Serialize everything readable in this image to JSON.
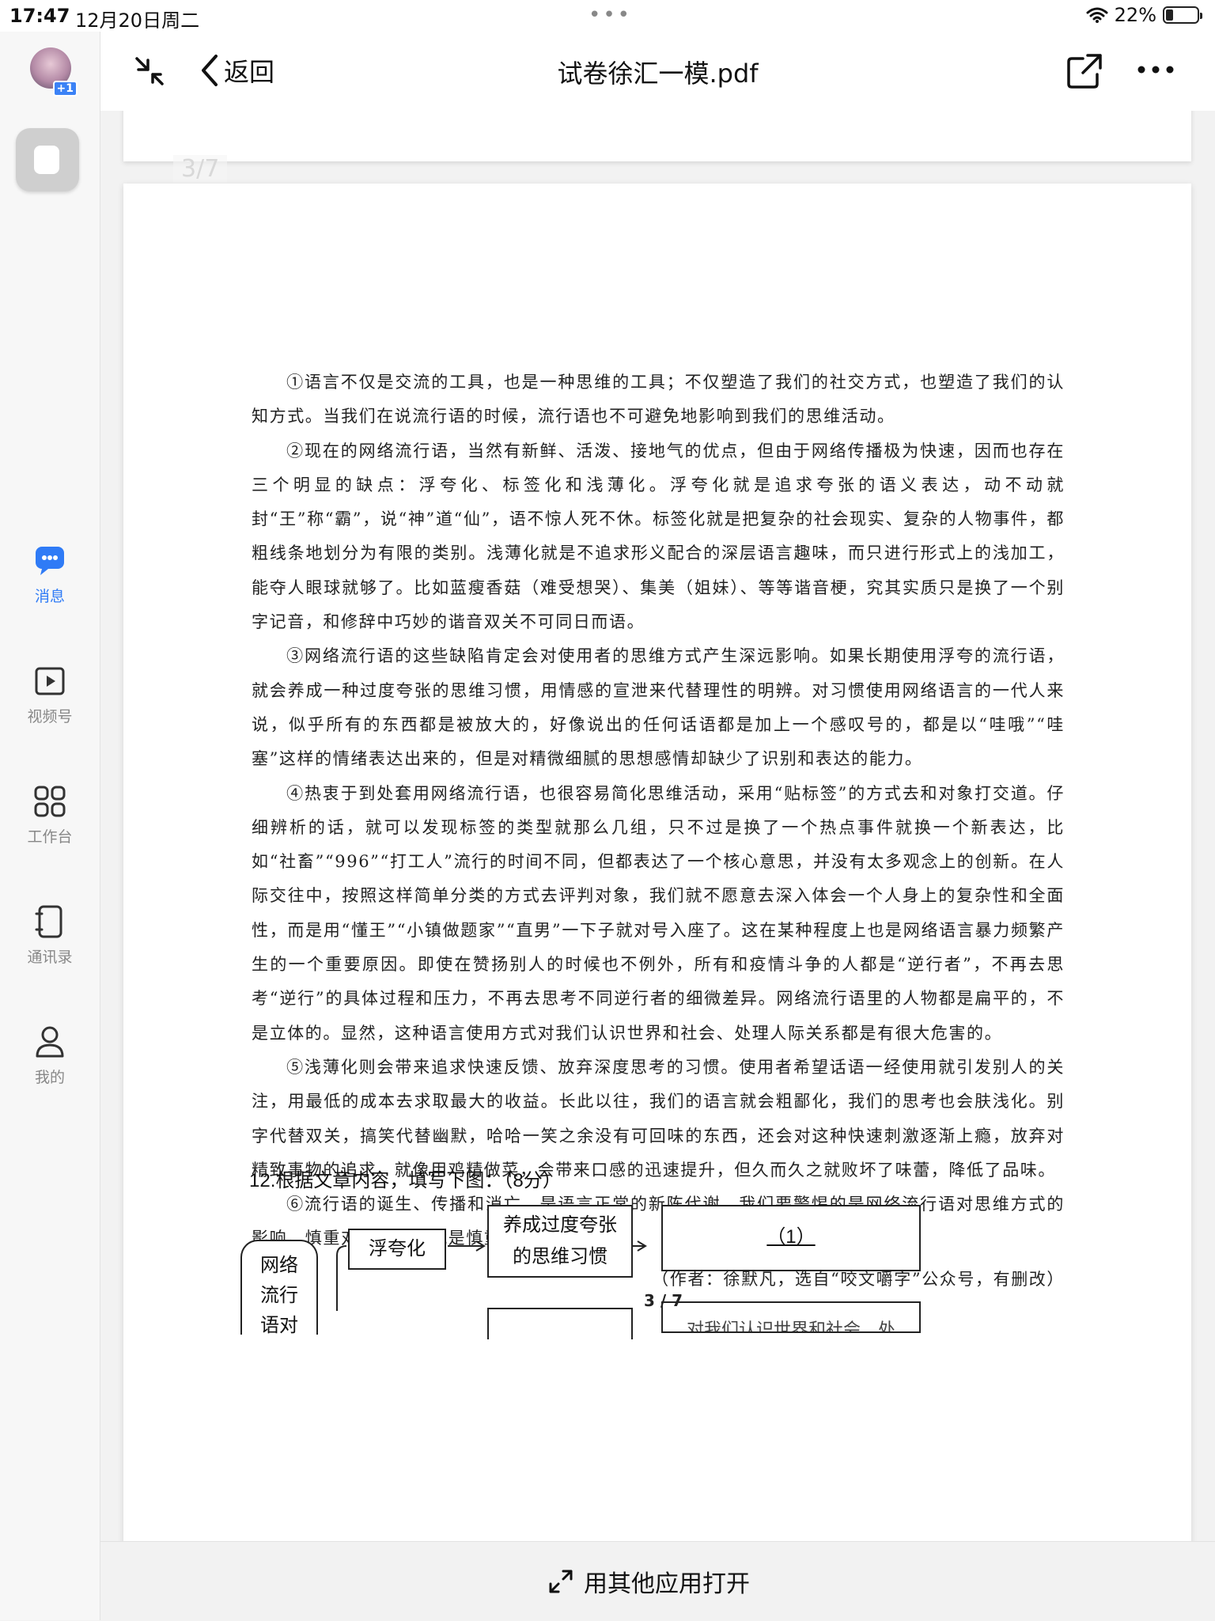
{
  "status_bar": {
    "time": "17:47",
    "date": "12月20日周二",
    "battery": "22%"
  },
  "sidebar": {
    "avatar_badge": "+1",
    "items": [
      {
        "label": "消息",
        "icon": "chat-icon",
        "active": true
      },
      {
        "label": "视频号",
        "icon": "video-channel-icon",
        "active": false
      },
      {
        "label": "工作台",
        "icon": "workbench-grid-icon",
        "active": false
      },
      {
        "label": "通讯录",
        "icon": "contacts-book-icon",
        "active": false
      },
      {
        "label": "我的",
        "icon": "profile-icon",
        "active": false
      }
    ]
  },
  "topbar": {
    "back_label": "返回",
    "title": "试卷徐汇一模.pdf"
  },
  "document": {
    "ghost_page_indicator": "3/7",
    "paragraphs": [
      "①语言不仅是交流的工具，也是一种思维的工具；不仅塑造了我们的社交方式，也塑造了我们的认知方式。当我们在说流行语的时候，流行语也不可避免地影响到我们的思维活动。",
      "②现在的网络流行语，当然有新鲜、活泼、接地气的优点，但由于网络传播极为快速，因而也存在三个明显的缺点：浮夸化、标签化和浅薄化。浮夸化就是追求夸张的语义表达，动不动就封“王”称“霸”，说“神”道“仙”，语不惊人死不休。标签化就是把复杂的社会现实、复杂的人物事件，都粗线条地划分为有限的类别。浅薄化就是不追求形义配合的深层语言趣味，而只进行形式上的浅加工，能夺人眼球就够了。比如蓝瘦香菇（难受想哭）、集美（姐妹）、等等谐音梗，究其实质只是换了一个别字记音，和修辞中巧妙的谐音双关不可同日而语。",
      "③网络流行语的这些缺陷肯定会对使用者的思维方式产生深远影响。如果长期使用浮夸的流行语，就会养成一种过度夸张的思维习惯，用情感的宣泄来代替理性的明辨。对习惯使用网络语言的一代人来说，似乎所有的东西都是被放大的，好像说出的任何话语都是加上一个感叹号的，都是以“哇哦”“哇塞”这样的情绪表达出来的，但是对精微细腻的思想感情却缺少了识别和表达的能力。",
      "④热衷于到处套用网络流行语，也很容易简化思维活动，采用“贴标签”的方式去和对象打交道。仔细辨析的话，就可以发现标签的类型就那么几组，只不过是换了一个热点事件就换一个新表达，比如“社畜”“996”“打工人”流行的时间不同，但都表达了一个核心意思，并没有太多观念上的创新。在人际交往中，按照这样简单分类的方式去评判对象，我们就不愿意去深入体会一个人身上的复杂性和全面性，而是用“懂王”“小镇做题家”“直男”一下子就对号入座了。这在某种程度上也是网络语言暴力频繁产生的一个重要原因。即使在赞扬别人的时候也不例外，所有和疫情斗争的人都是“逆行者”，不再去思考“逆行”的具体过程和压力，不再去思考不同逆行者的细微差异。网络流行语里的人物都是扁平的，不是立体的。显然，这种语言使用方式对我们认识世界和社会、处理人际关系都是有很大危害的。",
      "⑤浅薄化则会带来追求快速反馈、放弃深度思考的习惯。使用者希望话语一经使用就引发别人的关注，用最低的成本去求取最大的收益。长此以往，我们的语言就会粗鄙化，我们的思考也会肤浅化。别字代替双关，搞笑代替幽默，哈哈一笑之余没有可回味的东西，还会对这种快速刺激逐渐上瘾，放弃对精致事物的追求。就像用鸡精做菜，会带来口感的迅速提升，但久而久之就败坏了味蕾，降低了品味。",
      "⑥流行语的诞生、传播和消亡，是语言正常的新陈代谢。我们要警惕的是网络流行语对思维方式的影响。慎重对待语言，就是慎重对待我们的思想。"
    ],
    "source": "（作者：徐默凡，选自“咬文嚼字”公众号，有删改）",
    "question": "12.根据文章内容，填写下图：（8分）",
    "diagram": {
      "root_lines": [
        "网络",
        "流行",
        "语对"
      ],
      "branch1": "浮夸化",
      "effect1_lines": [
        "养成过度夸张",
        "的思维习惯"
      ],
      "blank1": "（1）",
      "partial_text": "对我们认识世界和社会、处"
    },
    "page_number": "3 / 7"
  },
  "bottom_bar": {
    "open_with_label": "用其他应用打开"
  }
}
